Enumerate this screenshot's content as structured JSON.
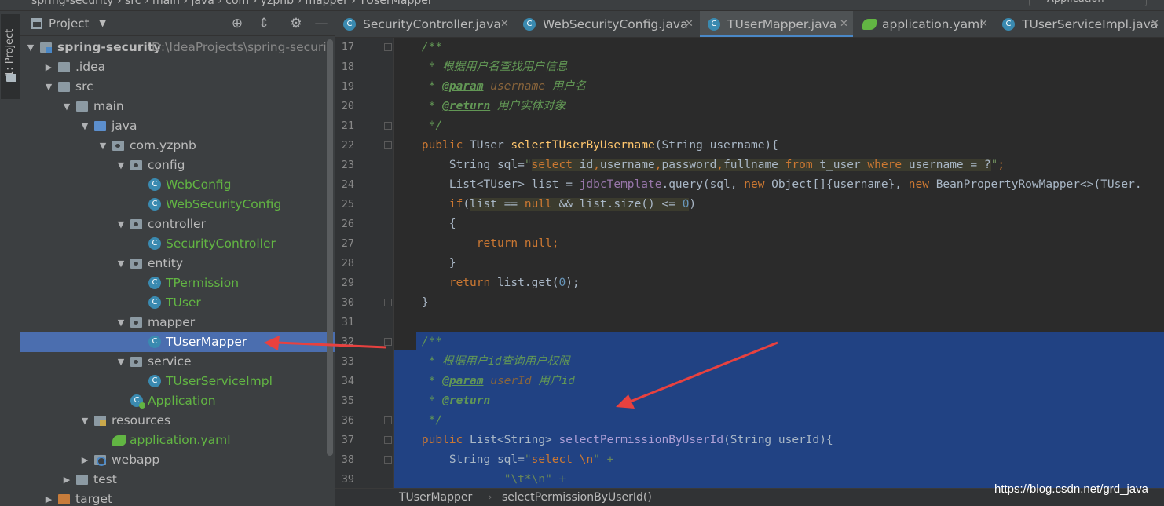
{
  "window": {
    "crumbs": "spring-security  ›  src  ›  main  ›  java  ›  com  ›  yzpnb  ›  mapper  ›  TUserMapper",
    "run_config": "Application"
  },
  "tool_stripe": {
    "project_tab": "1: Project"
  },
  "project_panel": {
    "title": "Project",
    "tree": [
      {
        "label": "spring-security",
        "path": "D:\\IdeaProjects\\spring-securi",
        "depth": 0,
        "expanded": true,
        "icon": "module-icon",
        "style": "bold"
      },
      {
        "label": ".idea",
        "depth": 1,
        "expanded": false,
        "icon": "folder-icon",
        "style": "plain"
      },
      {
        "label": "src",
        "depth": 1,
        "expanded": true,
        "icon": "folder-icon",
        "style": "plain"
      },
      {
        "label": "main",
        "depth": 2,
        "expanded": true,
        "icon": "folder-icon",
        "style": "plain"
      },
      {
        "label": "java",
        "depth": 3,
        "expanded": true,
        "icon": "source-folder-icon",
        "style": "plain"
      },
      {
        "label": "com.yzpnb",
        "depth": 4,
        "expanded": true,
        "icon": "package-icon",
        "style": "plain"
      },
      {
        "label": "config",
        "depth": 5,
        "expanded": true,
        "icon": "package-icon",
        "style": "plain"
      },
      {
        "label": "WebConfig",
        "depth": 6,
        "icon": "class-icon",
        "style": "green"
      },
      {
        "label": "WebSecurityConfig",
        "depth": 6,
        "icon": "class-icon",
        "style": "green"
      },
      {
        "label": "controller",
        "depth": 5,
        "expanded": true,
        "icon": "package-icon",
        "style": "plain"
      },
      {
        "label": "SecurityController",
        "depth": 6,
        "icon": "class-icon",
        "style": "green"
      },
      {
        "label": "entity",
        "depth": 5,
        "expanded": true,
        "icon": "package-icon",
        "style": "plain"
      },
      {
        "label": "TPermission",
        "depth": 6,
        "icon": "class-icon",
        "style": "green"
      },
      {
        "label": "TUser",
        "depth": 6,
        "icon": "class-icon",
        "style": "green"
      },
      {
        "label": "mapper",
        "depth": 5,
        "expanded": true,
        "icon": "package-icon",
        "style": "plain"
      },
      {
        "label": "TUserMapper",
        "depth": 6,
        "icon": "class-icon",
        "style": "green",
        "selected": true
      },
      {
        "label": "service",
        "depth": 5,
        "expanded": true,
        "icon": "package-icon",
        "style": "plain"
      },
      {
        "label": "TUserServiceImpl",
        "depth": 6,
        "icon": "class-icon",
        "style": "green"
      },
      {
        "label": "Application",
        "depth": 5,
        "icon": "spring-app-icon",
        "style": "green"
      },
      {
        "label": "resources",
        "depth": 3,
        "expanded": true,
        "icon": "resources-folder-icon",
        "style": "plain"
      },
      {
        "label": "application.yaml",
        "depth": 4,
        "icon": "yaml-icon",
        "style": "green"
      },
      {
        "label": "webapp",
        "depth": 3,
        "expanded": false,
        "icon": "web-folder-icon",
        "style": "plain"
      },
      {
        "label": "test",
        "depth": 2,
        "expanded": false,
        "icon": "folder-icon",
        "style": "plain"
      },
      {
        "label": "target",
        "depth": 1,
        "expanded": false,
        "icon": "excluded-folder-icon",
        "style": "plain"
      }
    ]
  },
  "editor_tabs": [
    {
      "label": "SecurityController.java",
      "icon": "class-icon",
      "active": false
    },
    {
      "label": "WebSecurityConfig.java",
      "icon": "class-icon",
      "active": false
    },
    {
      "label": "TUserMapper.java",
      "icon": "class-icon",
      "active": true
    },
    {
      "label": "application.yaml",
      "icon": "yaml-icon",
      "active": false
    },
    {
      "label": "TUserServiceImpl.java",
      "icon": "class-icon",
      "active": false
    }
  ],
  "code": {
    "line_numbers": [
      "17",
      "18",
      "19",
      "20",
      "21",
      "22",
      "23",
      "24",
      "25",
      "26",
      "27",
      "28",
      "29",
      "30",
      "31",
      "32",
      "33",
      "34",
      "35",
      "36",
      "37",
      "38",
      "39"
    ],
    "lines": [
      [
        {
          "t": "    /**",
          "c": "c-doc"
        }
      ],
      [
        {
          "t": "     * 根据用户名查找用户信息",
          "c": "c-doc"
        }
      ],
      [
        {
          "t": "     * ",
          "c": "c-doc"
        },
        {
          "t": "@param",
          "c": "c-tag"
        },
        {
          "t": " username",
          "c": "c-param"
        },
        {
          "t": " 用户名",
          "c": "c-doc"
        }
      ],
      [
        {
          "t": "     * ",
          "c": "c-doc"
        },
        {
          "t": "@return",
          "c": "c-tag"
        },
        {
          "t": " 用户实体对象",
          "c": "c-doc"
        }
      ],
      [
        {
          "t": "     */",
          "c": "c-doc"
        }
      ],
      [
        {
          "t": "    public ",
          "c": "kw"
        },
        {
          "t": "TUser ",
          "c": "txt"
        },
        {
          "t": "selectTUserByUsername",
          "c": "fn"
        },
        {
          "t": "(String username){",
          "c": "txt"
        }
      ],
      [
        {
          "t": "        String sql=",
          "c": "txt"
        },
        {
          "t": "\"",
          "c": "str"
        },
        {
          "t": "select ",
          "c": "sqlkw hl"
        },
        {
          "t": "id",
          "c": "sqltxt hl"
        },
        {
          "t": ",",
          "c": "kw hl"
        },
        {
          "t": "username",
          "c": "sqltxt hl"
        },
        {
          "t": ",",
          "c": "kw hl"
        },
        {
          "t": "password",
          "c": "sqltxt hl"
        },
        {
          "t": ",",
          "c": "kw hl"
        },
        {
          "t": "fullname ",
          "c": "sqltxt hl"
        },
        {
          "t": "from ",
          "c": "sqlkw hl"
        },
        {
          "t": "t_user ",
          "c": "sqltxt hl"
        },
        {
          "t": "where ",
          "c": "sqlkw hl"
        },
        {
          "t": "username = ?",
          "c": "sqltxt hl"
        },
        {
          "t": "\"",
          "c": "str"
        },
        {
          "t": ";",
          "c": "kw"
        }
      ],
      [
        {
          "t": "        List<TUser> list = ",
          "c": "txt"
        },
        {
          "t": "jdbcTemplate",
          "c": "field"
        },
        {
          "t": ".query(sql, ",
          "c": "txt"
        },
        {
          "t": "new ",
          "c": "kw"
        },
        {
          "t": "Object[]{username}, ",
          "c": "txt"
        },
        {
          "t": "new ",
          "c": "kw"
        },
        {
          "t": "BeanPropertyRowMapper<>(TUser.",
          "c": "txt"
        }
      ],
      [
        {
          "t": "        ",
          "c": "txt"
        },
        {
          "t": "if",
          "c": "kw"
        },
        {
          "t": "(",
          "c": "txt"
        },
        {
          "t": "list == ",
          "c": "txt hl"
        },
        {
          "t": "null ",
          "c": "kw hl"
        },
        {
          "t": "&& list.size() <= ",
          "c": "txt hl"
        },
        {
          "t": "0",
          "c": "num hl"
        },
        {
          "t": ")",
          "c": "txt"
        }
      ],
      [
        {
          "t": "        {",
          "c": "txt"
        }
      ],
      [
        {
          "t": "            ",
          "c": "txt"
        },
        {
          "t": "return null",
          "c": "kw"
        },
        {
          "t": ";",
          "c": "kw"
        }
      ],
      [
        {
          "t": "        }",
          "c": "txt"
        }
      ],
      [
        {
          "t": "        ",
          "c": "txt"
        },
        {
          "t": "return ",
          "c": "kw"
        },
        {
          "t": "list.get(",
          "c": "txt"
        },
        {
          "t": "0",
          "c": "num"
        },
        {
          "t": ");",
          "c": "txt"
        }
      ],
      [
        {
          "t": "    }",
          "c": "txt"
        }
      ],
      [
        {
          "t": "",
          "c": "txt"
        }
      ],
      [
        {
          "t": "    /**",
          "c": "c-doc"
        }
      ],
      [
        {
          "t": "     * 根据用户id查询用户权限",
          "c": "c-doc"
        }
      ],
      [
        {
          "t": "     * ",
          "c": "c-doc"
        },
        {
          "t": "@param",
          "c": "c-tag"
        },
        {
          "t": " userId",
          "c": "c-param"
        },
        {
          "t": " 用户id",
          "c": "c-doc"
        }
      ],
      [
        {
          "t": "     * ",
          "c": "c-doc"
        },
        {
          "t": "@return",
          "c": "c-tag"
        }
      ],
      [
        {
          "t": "     */",
          "c": "c-doc"
        }
      ],
      [
        {
          "t": "    public ",
          "c": "kw"
        },
        {
          "t": "List<String> ",
          "c": "txt"
        },
        {
          "t": "selectPermissionByUserId",
          "c": "fn-dim"
        },
        {
          "t": "(String userId){",
          "c": "txt"
        }
      ],
      [
        {
          "t": "        String sql=",
          "c": "txt"
        },
        {
          "t": "\"",
          "c": "str"
        },
        {
          "t": "select ",
          "c": "sqlkw"
        },
        {
          "t": "\\n",
          "c": "kw"
        },
        {
          "t": "\" +",
          "c": "str"
        }
      ],
      [
        {
          "t": "                ",
          "c": "txt"
        },
        {
          "t": "\"\\t*\\n\" +",
          "c": "str"
        }
      ]
    ]
  },
  "navbar": {
    "class_crumb": "TUserMapper",
    "method_crumb": "selectPermissionByUserId()"
  },
  "watermark": "https://blog.csdn.net/grd_java",
  "colors": {
    "selection": "#214283",
    "tree_selected": "#4b6eaf",
    "arrow": "#e8413f"
  }
}
